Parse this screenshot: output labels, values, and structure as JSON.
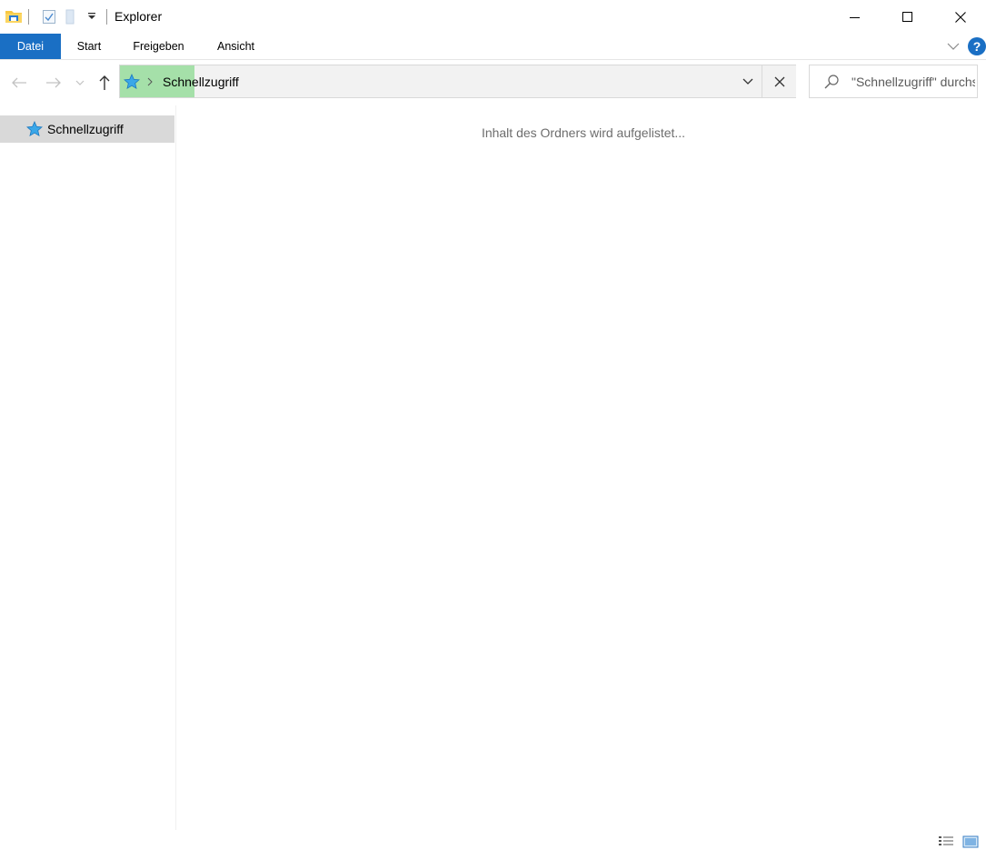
{
  "window": {
    "title": "Explorer",
    "icons": {
      "app": "file-explorer-folder-icon",
      "properties": "properties-check-icon",
      "new_folder": "new-folder-icon",
      "customize": "dropdown-arrow-icon",
      "minimize": "minimize-icon",
      "maximize": "maximize-icon",
      "close": "close-icon"
    }
  },
  "ribbon": {
    "tabs": [
      {
        "label": "Datei",
        "active": true
      },
      {
        "label": "Start"
      },
      {
        "label": "Freigeben"
      },
      {
        "label": "Ansicht"
      }
    ],
    "help_label": "?",
    "accent_color": "#1a6fc4"
  },
  "navigation": {
    "address": {
      "location": "Schnellzugriff",
      "progress_fraction": 0.11,
      "progress_color": "#a5e0a9"
    },
    "search": {
      "placeholder": "\"Schnellzugriff\" durchsuchen"
    }
  },
  "nav_pane": {
    "items": [
      {
        "label": "Schnellzugriff",
        "icon": "quick-access-star-icon",
        "selected": true
      }
    ]
  },
  "content": {
    "status_text": "Inhalt des Ordners wird aufgelistet..."
  },
  "statusbar": {
    "views": [
      "details-view-icon",
      "large-icons-view-icon"
    ]
  }
}
